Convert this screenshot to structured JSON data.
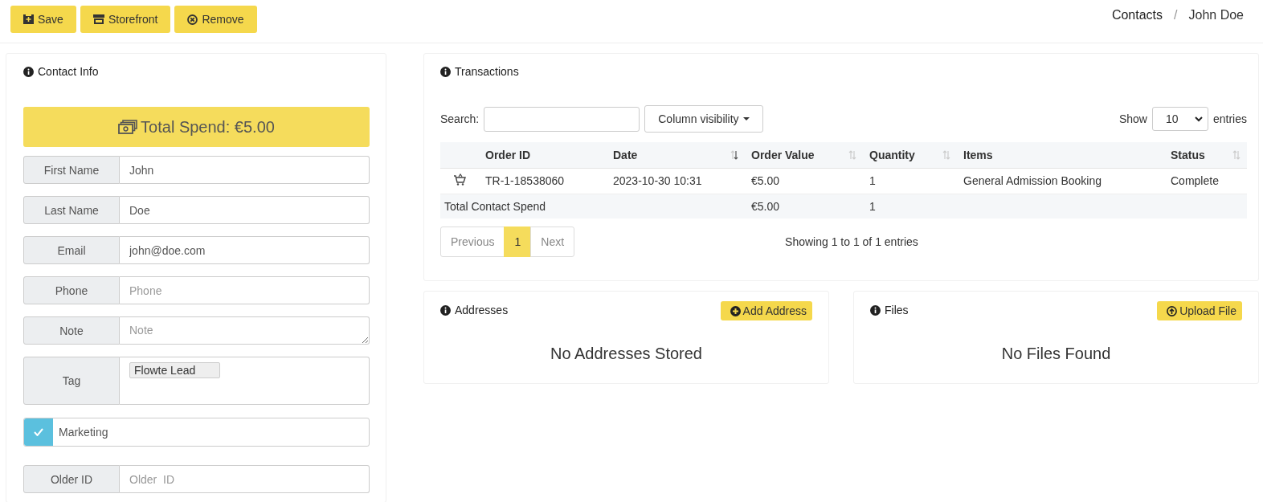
{
  "toolbar": {
    "buttons": [
      "Save",
      "Storefront",
      "Remove"
    ]
  },
  "breadcrumb": {
    "items": [
      "Contacts",
      "John Doe"
    ],
    "separator": "/"
  },
  "contact_info": {
    "title": "Contact Info",
    "total_spend": "Total Spend: €5.00",
    "fields": [
      {
        "kind": "text",
        "label": "First Name",
        "value": "John"
      },
      {
        "kind": "text",
        "label": "Last Name",
        "value": "Doe"
      },
      {
        "kind": "text",
        "label": "Email",
        "value": "john@doe.com"
      },
      {
        "kind": "text",
        "label": "Phone",
        "placeholder": "Phone"
      },
      {
        "kind": "textarea",
        "label": "Note",
        "placeholder": "Note"
      },
      {
        "kind": "tags",
        "label": "Tag",
        "tags": [
          "Flowte Lead"
        ]
      },
      {
        "kind": "checkbox",
        "label": "Marketing",
        "checked": true
      },
      {
        "kind": "text",
        "label": "Older ID",
        "placeholder": "Older  ID"
      }
    ]
  },
  "transactions": {
    "title": "Transactions",
    "search_label": "Search:",
    "column_visibility": "Column visibility",
    "show_label": "Show",
    "page_size": "10",
    "entries_label": "entries",
    "columns": [
      {
        "label": "Order ID",
        "sortable": false
      },
      {
        "label": "Date",
        "sortable": true,
        "sorted": true
      },
      {
        "label": "Order Value",
        "sortable": true,
        "sorted": false
      },
      {
        "label": "Quantity",
        "sortable": true,
        "sorted": false
      },
      {
        "label": "Items",
        "sortable": false
      },
      {
        "label": "Status",
        "sortable": true,
        "sorted": false
      }
    ],
    "rows": [
      [
        "TR-1-18538060",
        "2023-10-30 10:31",
        "€5.00",
        "1",
        "General Admission Booking",
        "Complete"
      ]
    ],
    "total_row": {
      "label": "Total Contact Spend",
      "order_value": "€5.00",
      "quantity": "1"
    },
    "pagination": [
      {
        "label": "Previous",
        "disabled": true
      },
      {
        "label": "1",
        "selected": true
      },
      {
        "label": "Next",
        "disabled": true
      }
    ],
    "info": "Showing 1 to 1 of 1 entries"
  },
  "addresses": {
    "title": "Addresses",
    "button": "Add Address",
    "empty": "No Addresses Stored"
  },
  "files": {
    "title": "Files",
    "button": "Upload File",
    "empty": "No Files Found"
  }
}
